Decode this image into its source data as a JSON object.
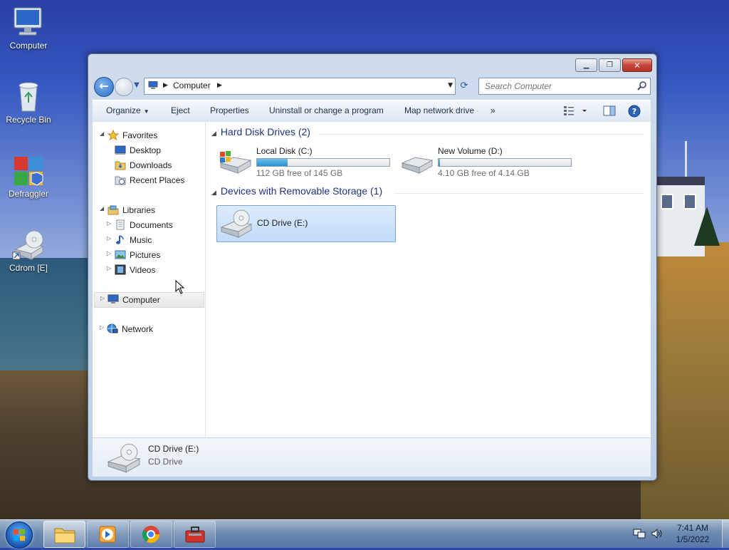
{
  "desktop": {
    "icons": [
      {
        "label": "Computer"
      },
      {
        "label": "Recycle Bin"
      },
      {
        "label": "Defraggler"
      },
      {
        "label": "Cdrom [E]"
      }
    ]
  },
  "window": {
    "address": {
      "segments": [
        "Computer"
      ],
      "search_placeholder": "Search Computer"
    },
    "toolbar": {
      "organize": "Organize",
      "eject": "Eject",
      "properties": "Properties",
      "uninstall": "Uninstall or change a program",
      "map_drive": "Map network drive",
      "more": "»"
    },
    "nav": {
      "favorites": "Favorites",
      "desktop": "Desktop",
      "downloads": "Downloads",
      "recent": "Recent Places",
      "libraries": "Libraries",
      "documents": "Documents",
      "music": "Music",
      "pictures": "Pictures",
      "videos": "Videos",
      "computer": "Computer",
      "network": "Network"
    },
    "content": {
      "hdd_group": "Hard Disk Drives (2)",
      "removable_group": "Devices with Removable Storage (1)",
      "drives": [
        {
          "name": "Local Disk (C:)",
          "free": "112 GB free of 145 GB",
          "used_fraction": 0.23
        },
        {
          "name": "New Volume (D:)",
          "free": "4.10 GB free of 4.14 GB",
          "used_fraction": 0.01
        }
      ],
      "removable": [
        {
          "name": "CD Drive (E:)"
        }
      ]
    },
    "details": {
      "name": "CD Drive (E:)",
      "type": "CD Drive"
    }
  },
  "taskbar": {
    "time": "7:41 AM",
    "date": "1/5/2022"
  },
  "colors": {
    "accent": "#1e3287",
    "progress": "#2a8fd0",
    "selection": "#c1dcfc"
  }
}
